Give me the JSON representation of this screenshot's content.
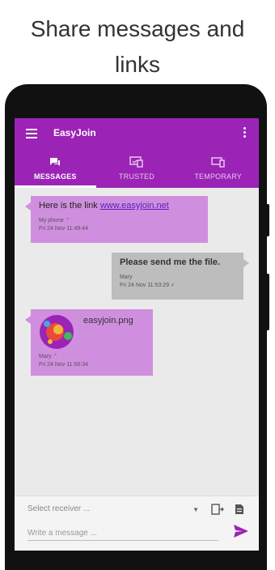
{
  "headline": {
    "line1": "Share messages and",
    "line2": "links"
  },
  "app": {
    "title": "EasyJoin"
  },
  "tabs": [
    {
      "label": "MESSAGES",
      "icon": "chat-icon",
      "active": true
    },
    {
      "label": "TRUSTED",
      "icon": "trusted-devices-icon",
      "active": false
    },
    {
      "label": "TEMPORARY",
      "icon": "temporary-devices-icon",
      "active": false
    }
  ],
  "messages": [
    {
      "text_prefix": "Here is the link ",
      "link": "www.easyjoin.net",
      "sender": "My phone",
      "time": "Fri 24 Nov 11:49:44",
      "direction": "out"
    },
    {
      "text": "Please send me the file.",
      "sender": "Mary",
      "time": "Fri 24 Nov 11:53:29",
      "direction": "in"
    },
    {
      "file": "easyjoin.png",
      "sender": "Mary",
      "time": "Fri 24 Nov 11:56:34",
      "direction": "out"
    }
  ],
  "input": {
    "receiver_placeholder": "Select receiver ...",
    "message_placeholder": "Write a message ..."
  },
  "colors": {
    "accent": "#9b23b5",
    "bubble_out": "#cf8fde",
    "bubble_in": "#bdbdbd",
    "send": "#9b23b5"
  }
}
